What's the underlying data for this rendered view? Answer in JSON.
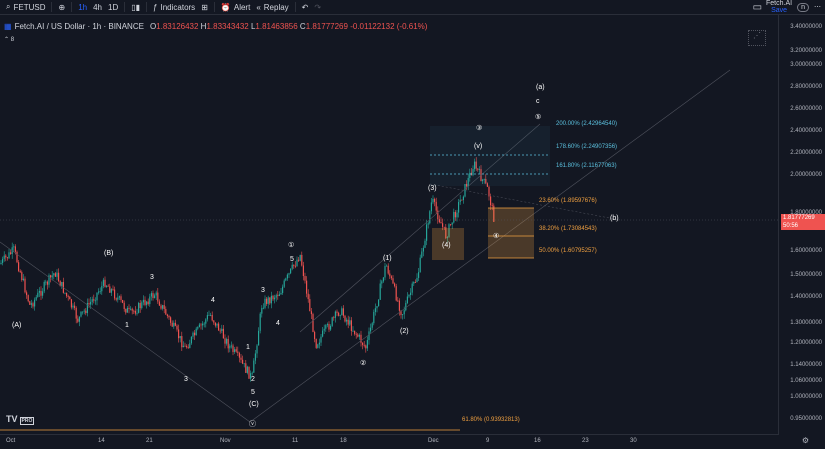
{
  "toolbar": {
    "symbol": "FETUSD",
    "intervals": [
      "1h",
      "4h",
      "1D"
    ],
    "indicators_label": "Indicators",
    "alert_label": "Alert",
    "replay_label": "Replay",
    "account_name": "Fetch.AI",
    "account_sub": "Save",
    "account_code": "n"
  },
  "legend": {
    "title": "Fetch.AI / US Dollar · 1h · BINANCE",
    "o": "1.83126432",
    "h": "1.83343432",
    "l": "1.81463856",
    "c": "1.81777269",
    "change": "-0.01122132 (-0.61%)",
    "sub": "8"
  },
  "price_axis": {
    "ticks": [
      "3.40000000",
      "3.20000000",
      "3.00000000",
      "2.80000000",
      "2.60000000",
      "2.40000000",
      "2.20000000",
      "2.00000000",
      "1.80000000",
      "1.70000000",
      "1.60000000",
      "1.50000000",
      "1.40000000",
      "1.30000000",
      "1.20000000",
      "1.14000000",
      "1.06000000",
      "1.00000000",
      "0.95000000"
    ],
    "last_price": "1.81777269",
    "countdown": "50:56"
  },
  "time_axis": {
    "ticks": [
      "Oct",
      "14",
      "21",
      "Nov",
      "11",
      "18",
      "Dec",
      "9",
      "16",
      "23",
      "30"
    ]
  },
  "fib_levels": [
    {
      "label": "200.00% (2.42964540)",
      "color": "#5bc0de"
    },
    {
      "label": "178.60% (2.24907356)",
      "color": "#5bc0de"
    },
    {
      "label": "161.80% (2.11677063)",
      "color": "#5bc0de"
    },
    {
      "label": "23.60% (1.89597676)",
      "color": "#f0a040"
    },
    {
      "label": "38.20% (1.73084543)",
      "color": "#f0a040"
    },
    {
      "label": "50.00% (1.60795257)",
      "color": "#f0a040"
    },
    {
      "label": "61.80% (0.93932813)",
      "color": "#f0a040"
    }
  ],
  "wave_labels": {
    "a_big": "(a)",
    "c_small": "c",
    "five_circ": "⑤",
    "b_big": "(b)",
    "three_circ": "③",
    "v_sub": "(v)",
    "three_paren": "(3)",
    "four_paren": "(4)",
    "one_paren": "(1)",
    "two_paren": "(2)",
    "two_circ": "②",
    "one_circ": "①",
    "five": "5",
    "A_paren": "(A)",
    "B_paren": "(B)",
    "C_paren": "(C)",
    "iii": "3",
    "iv": "4",
    "i": "1",
    "ii": "2",
    "iv_circ": "④",
    "v_circ": "ⓥ"
  },
  "brand": {
    "logo": "TV",
    "pro": "PRO"
  },
  "colors": {
    "up": "#26a69a",
    "down": "#ef5350",
    "fib_up": "#5bc0de",
    "fib_down": "#f0a040",
    "bg": "#131722"
  }
}
